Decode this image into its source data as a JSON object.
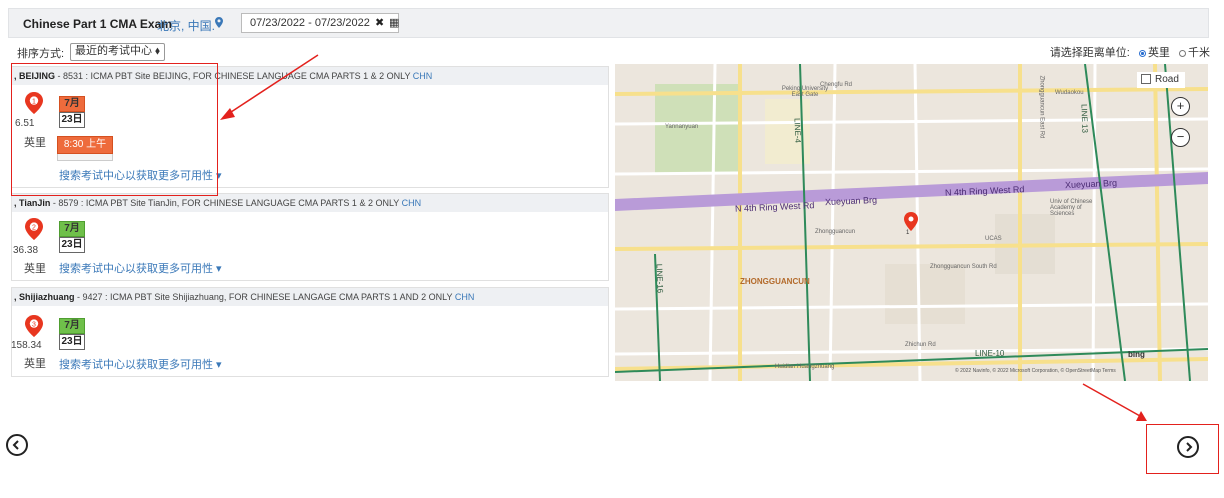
{
  "header": {
    "exam_title": "Chinese Part 1 CMA Exam",
    "location": "北京, 中国.",
    "date_range": "07/23/2022 - 07/23/2022",
    "clear_glyph": "✖",
    "calendar_glyph": "▦"
  },
  "sort": {
    "label": "排序方式:",
    "selected": "最近的考试中心 ⬧"
  },
  "distance_unit": {
    "label": "请选择距离单位:",
    "options": [
      "英里",
      "千米"
    ],
    "selected": "英里"
  },
  "centers": [
    {
      "city": ", BEIJING",
      "desc": " - 8531 : ICMA PBT Site BEIJING, FOR CHINESE LANGUAGE CMA PARTS 1 & 2 ONLY ",
      "country": "CHN",
      "index": "1",
      "distance": "6.51",
      "unit": "英里",
      "month": "7月",
      "day": "23日",
      "time": "8:30 上午",
      "more": "搜索考试中心以获取更多可用性 ▾",
      "marker_color": "#e8361f",
      "month_color": "#ee6b3c"
    },
    {
      "city": ", TianJin",
      "desc": " - 8579 : ICMA PBT Site TianJin, FOR CHINESE LANGUAGE CMA PARTS 1 & 2 ONLY ",
      "country": "CHN",
      "index": "2",
      "distance": "36.38",
      "unit": "英里",
      "month": "7月",
      "day": "23日",
      "more": "搜索考试中心以获取更多可用性 ▾",
      "marker_color": "#e8361f",
      "month_color": "#6fc04a"
    },
    {
      "city": ", Shijiazhuang",
      "desc": " - 9427 : ICMA PBT Site Shijiazhuang, FOR CHINESE LANGAGE CMA PARTS 1 AND 2 ONLY ",
      "country": "CHN",
      "index": "3",
      "distance": "158.34",
      "unit": "英里",
      "month": "7月",
      "day": "23日",
      "more": "搜索考试中心以获取更多可用性 ▾",
      "marker_color": "#e8361f",
      "month_color": "#6fc04a"
    }
  ],
  "map": {
    "layer_label": "Road",
    "zoom_in": "+",
    "zoom_out": "−",
    "marker_index": "1",
    "labels": {
      "district": "ZHONGGUANCUN",
      "ring_road_1": "N 4th Ring West Rd",
      "ring_road_2": "Xueyuan Brg",
      "ring_road_3": "N 4th Ring West Rd",
      "ring_road_4": "Xueyuan Brg",
      "peking_univ": "Peking University East Gate",
      "zhongguancun_stn": "Zhongguancun",
      "ucas": "UCAS",
      "univ_sci": "Univ of Chinese Academy of Sciences",
      "chengfu": "Chengfu Rd",
      "line4": "LINE-4",
      "line10": "LINE-10",
      "line13": "LINE 13",
      "line16": "LINE-16",
      "wudaokou": "Wudaokou",
      "haidian": "Haidian Huangzhuang",
      "zhichun": "Zhichun Rd",
      "zgc_south": "Zhongguancun South Rd",
      "zgc_east": "Zhongguancun East Rd",
      "yannanyuan": "Yannanyuan",
      "logo": "bing",
      "copyright": "© 2022 Navinfo, © 2022 Microsoft Corporation, © OpenStreetMap  Terms"
    }
  },
  "nav": {
    "prev_glyph": "‹",
    "next_glyph": "›"
  },
  "colors": {
    "accent": "#3a78b8",
    "highlight": "#e3211d"
  }
}
